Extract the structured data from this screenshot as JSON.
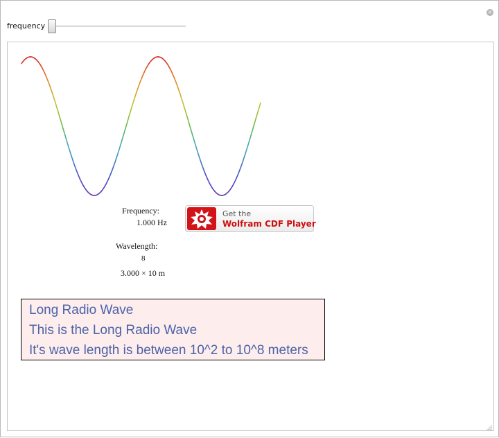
{
  "controls": {
    "frequency_label": "frequency",
    "slider_position": 0.0
  },
  "close_icon": "close-circle-icon",
  "readout": {
    "frequency_label": "Frequency:",
    "frequency_value": "1.000 Hz",
    "wavelength_label": "Wavelength:",
    "wavelength_exponent": "8",
    "wavelength_value": "3.000 × 10 m"
  },
  "cdf_button": {
    "line1": "Get the",
    "line2": "Wolfram CDF Player",
    "logo_icon": "wolfram-spikey-icon",
    "brand_color": "#d21317"
  },
  "wave_info": {
    "lines": [
      "Long Radio Wave",
      "This is the Long Radio Wave",
      "It's wave length is between 10^2 to 10^8 meters"
    ],
    "background_color": "#feeded",
    "text_color": "#4a63a8"
  },
  "wave_colors": [
    "#d62b2b",
    "#e58a2e",
    "#c8c43a",
    "#6cbf4e",
    "#49a9c9",
    "#4a5fc9",
    "#6a3ab4"
  ]
}
